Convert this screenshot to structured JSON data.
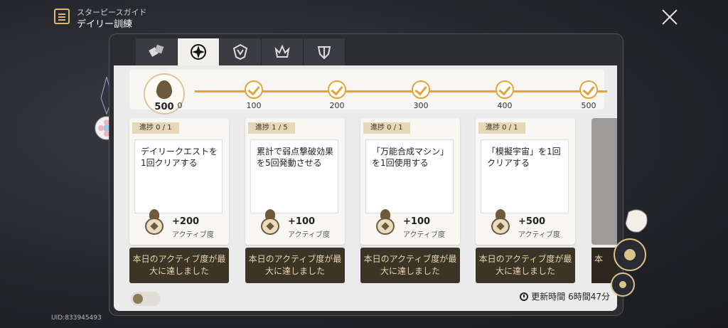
{
  "header": {
    "crumb": "スターピースガイド",
    "title": "デイリー訓練"
  },
  "tabs": [
    {
      "name": "tab-1",
      "icon": "blocks-icon",
      "active": false
    },
    {
      "name": "tab-2",
      "icon": "cross-emblem-icon",
      "active": true
    },
    {
      "name": "tab-3",
      "icon": "shield-emblem-icon",
      "active": false
    },
    {
      "name": "tab-4",
      "icon": "crown-emblem-icon",
      "active": false
    },
    {
      "name": "tab-5",
      "icon": "helmet-emblem-icon",
      "active": false
    }
  ],
  "progress": {
    "current": "500",
    "ticks": [
      "0",
      "100",
      "200",
      "300",
      "400",
      "500"
    ]
  },
  "cards": [
    {
      "progress": "進捗  0 / 1",
      "desc": "デイリークエストを1回クリアする",
      "amount": "+200",
      "unit": "アクティブ度",
      "status": "本日のアクティブ度が最大に達しました"
    },
    {
      "progress": "進捗  1 / 5",
      "desc": "累計で弱点撃破効果を5回発動させる",
      "amount": "+100",
      "unit": "アクティブ度",
      "status": "本日のアクティブ度が最大に達しました"
    },
    {
      "progress": "進捗  0 / 1",
      "desc": "「万能合成マシン」を1回使用する",
      "amount": "+100",
      "unit": "アクティブ度",
      "status": "本日のアクティブ度が最大に達しました"
    },
    {
      "progress": "進捗  0 / 1",
      "desc": "「模擬宇宙」を1回クリアする",
      "amount": "+500",
      "unit": "アクティブ度",
      "status": "本日のアクティブ度が最大に達しました"
    }
  ],
  "partial_card": {
    "status": "本"
  },
  "refresh": "更新時間 6時間47分",
  "uid": "UID:833945493",
  "colors": {
    "accent": "#e2a33c",
    "status_bg": "#3d3428",
    "status_text": "#e8d6ad"
  }
}
